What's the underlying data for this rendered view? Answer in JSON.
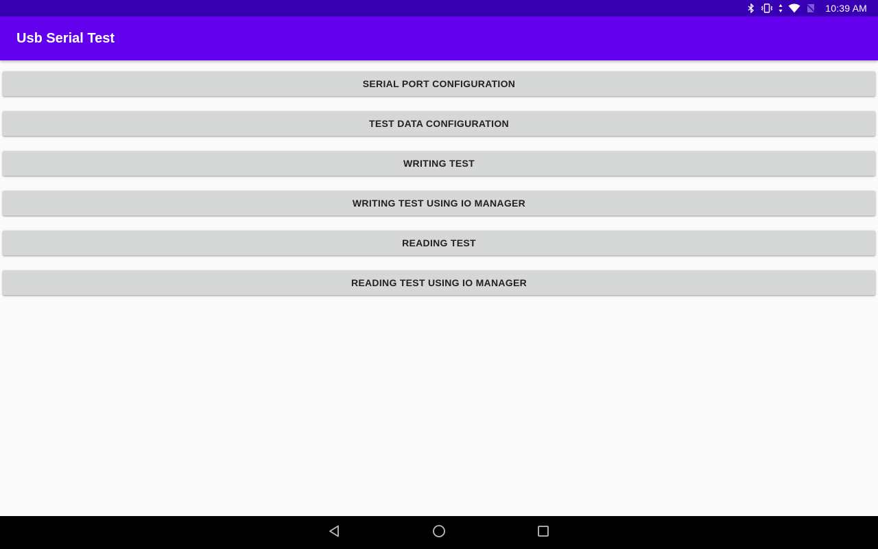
{
  "status_bar": {
    "time": "10:39 AM",
    "icons": [
      "bluetooth-icon",
      "vibrate-icon",
      "data-arrows-icon",
      "wifi-icon",
      "no-sim-icon"
    ]
  },
  "app_bar": {
    "title": "Usb Serial Test"
  },
  "menu": {
    "buttons": [
      {
        "label": "SERIAL PORT CONFIGURATION"
      },
      {
        "label": "TEST DATA CONFIGURATION"
      },
      {
        "label": "WRITING TEST"
      },
      {
        "label": "WRITING TEST USING IO MANAGER"
      },
      {
        "label": "READING TEST"
      },
      {
        "label": "READING TEST USING IO MANAGER"
      }
    ]
  },
  "nav_bar": {
    "icons": [
      "back-icon",
      "home-icon",
      "recents-icon"
    ]
  },
  "colors": {
    "status_bar": "#3700b3",
    "app_bar": "#6200ee",
    "button_bg": "#d6d7d7",
    "background": "#fafafa"
  }
}
